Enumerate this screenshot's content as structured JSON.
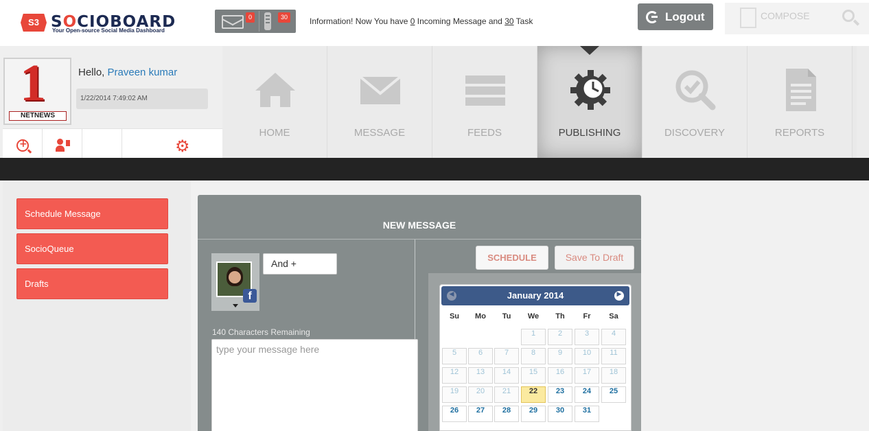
{
  "header": {
    "logo_badge": "S3",
    "logo_text_a": "S",
    "logo_text_o": "O",
    "logo_text_b": "CIOBOARD",
    "logo_tagline": "Your Open-source Social Media Dashboard",
    "message_count": "0",
    "task_count": "30",
    "info_prefix": "Information! Now You have ",
    "info_incoming": "0",
    "info_middle": " Incoming Message and ",
    "info_tasks": "30",
    "info_suffix": " Task",
    "logout_label": "Logout",
    "compose_label": "COMPOSE"
  },
  "profile": {
    "avatar_text": "1",
    "avatar_caption": "NETNEWS",
    "hello": "Hello, ",
    "username": "Praveen kumar",
    "datetime": "1/22/2014 7:49:02 AM"
  },
  "nav": {
    "items": [
      {
        "label": "HOME",
        "icon": "home-icon"
      },
      {
        "label": "MESSAGE",
        "icon": "envelope-icon"
      },
      {
        "label": "FEEDS",
        "icon": "list-icon"
      },
      {
        "label": "PUBLISHING",
        "icon": "gear-clock-icon"
      },
      {
        "label": "DISCOVERY",
        "icon": "magnifier-check-icon"
      },
      {
        "label": "REPORTS",
        "icon": "document-icon"
      }
    ],
    "active": "PUBLISHING"
  },
  "sidebar": {
    "items": [
      {
        "label": "Schedule Message"
      },
      {
        "label": "SocioQueue"
      },
      {
        "label": "Drafts"
      }
    ]
  },
  "compose": {
    "title": "NEW MESSAGE",
    "and_label": "And +",
    "fb_glyph": "f",
    "chars_remaining": "140 Characters Remaining",
    "message_placeholder": "type your message here",
    "schedule_label": "SCHEDULE",
    "draft_label": "Save To Draft"
  },
  "calendar": {
    "month_label": "January 2014",
    "prev_glyph": "◀",
    "next_glyph": "▶",
    "days_of_week": [
      "Su",
      "Mo",
      "Tu",
      "We",
      "Th",
      "Fr",
      "Sa"
    ],
    "first_weekday": 3,
    "days_in_month": 31,
    "today": 22
  },
  "colors": {
    "accent_red": "#f35b52",
    "brand_navy": "#1c2a52",
    "calendar_header": "#3d5a89",
    "link_blue": "#2b7bb9"
  }
}
